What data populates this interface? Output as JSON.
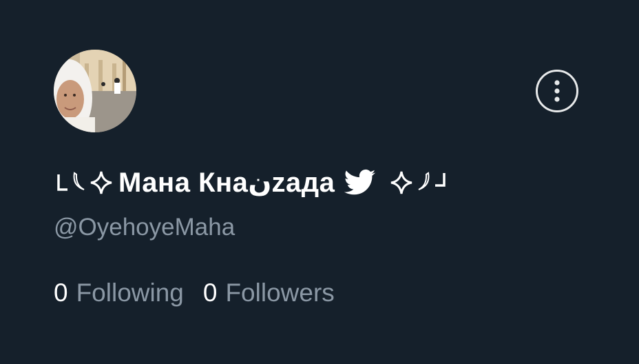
{
  "profile": {
    "display_name": "Мана Кнаنzaда",
    "handle": "@OyehoyeMaha",
    "verified_icon": "twitter-bird-icon",
    "decorations": [
      "corner-bracket-left",
      "crescent-left",
      "sparkle-left",
      "sparkle-right",
      "crescent-right",
      "corner-bracket-right"
    ]
  },
  "stats": {
    "following_count": "0",
    "following_label": "Following",
    "followers_count": "0",
    "followers_label": "Followers"
  },
  "actions": {
    "more_icon": "more-vertical-icon"
  },
  "colors": {
    "background": "#15202b",
    "primary_text": "#ffffff",
    "secondary_text": "#8b98a5"
  }
}
